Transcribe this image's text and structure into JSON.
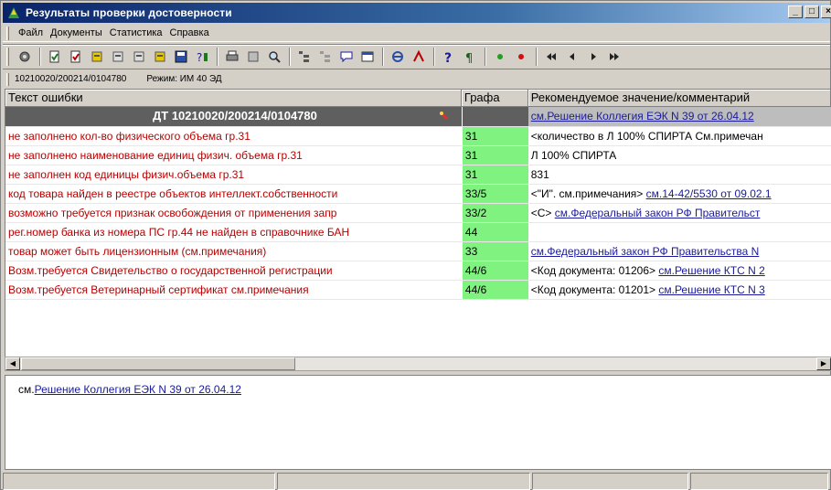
{
  "window": {
    "title": "Результаты проверки достоверности",
    "buttons": [
      "_",
      "□",
      "×"
    ]
  },
  "menu": [
    {
      "label": "Файл"
    },
    {
      "label": "Документы"
    },
    {
      "label": "Статистика"
    },
    {
      "label": "Справка"
    }
  ],
  "toolbar_icons": [
    "gear-icon",
    "doc-check-icon",
    "doc-check2-icon",
    "book-icon",
    "book2-icon",
    "book3-icon",
    "book4-icon",
    "save-icon",
    "help-filter-icon",
    "print-icon",
    "print-preview-icon",
    "magnifier-icon",
    "tree-icon",
    "tree2-icon",
    "comment-icon",
    "properties-icon",
    "stop-icon",
    "run-icon",
    "help-icon",
    "paragraph-icon",
    "green-dot-icon",
    "red-dot-icon",
    "first-icon",
    "prev-icon",
    "next-icon",
    "last-icon"
  ],
  "infobar": {
    "doc_number": "10210020/200214/0104780",
    "mode": "Режим: ИМ 40 ЭД"
  },
  "grid": {
    "headers": [
      "Текст ошибки",
      "Графа",
      "Рекомендуемое значение/комментарий"
    ],
    "group": {
      "label": "ДТ 10210020/200214/0104780",
      "comment_link": "см.Решение Коллегия ЕЭК N 39 от 26.04.12"
    },
    "rows": [
      {
        "error": "не заполнено кол-во физического объема гр.31",
        "col": "31",
        "comment_prefix": "<количество в Л 100% СПИРТА См.примечан",
        "comment_link": ""
      },
      {
        "error": "не заполнено наименование единиц физич. объема гр.31",
        "col": "31",
        "comment_prefix": "Л 100% СПИРТА",
        "comment_link": ""
      },
      {
        "error": "не заполнен код единицы физич.объема гр.31",
        "col": "31",
        "comment_prefix": "831",
        "comment_link": ""
      },
      {
        "error": "код товара найден в реестре объектов интеллект.собственности",
        "col": "33/5",
        "comment_prefix": "<\"И\". см.примечания> ",
        "comment_link": "см.14-42/5530 от 09.02.1"
      },
      {
        "error": "возможно требуется признак освобождения от применения запр",
        "col": "33/2",
        "comment_prefix": "<С> ",
        "comment_link": "см.Федеральный закон РФ Правительст"
      },
      {
        "error": "рег.номер банка из номера ПС гр.44 не найден в справочнике БАН",
        "col": "44",
        "comment_prefix": "",
        "comment_link": ""
      },
      {
        "error": "товар может быть лицензионным (см.примечания)",
        "col": "33",
        "comment_prefix": "",
        "comment_link": "см.Федеральный закон РФ Правительства N"
      },
      {
        "error": "Возм.требуется Свидетельство о государственной регистрации",
        "col": "44/6",
        "comment_prefix": "<Код документа: 01206> ",
        "comment_link": "см.Решение КТС N 2"
      },
      {
        "error": "Возм.требуется Ветеринарный сертификат см.примечания",
        "col": "44/6",
        "comment_prefix": "<Код документа: 01201> ",
        "comment_link": "см.Решение КТС N 3"
      }
    ]
  },
  "memo": {
    "prefix": "см.",
    "link": "Решение Коллегия ЕЭК N 39 от 26.04.12"
  },
  "colors": {
    "titlebar": "#0a246a",
    "error_text": "#b80000",
    "graph_cell": "#7ff27f",
    "group_row": "#5f5f5f",
    "link": "#1a1a9e"
  }
}
